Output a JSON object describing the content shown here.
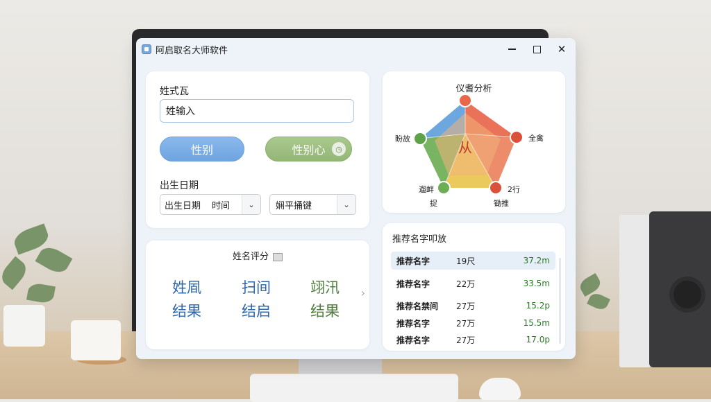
{
  "window": {
    "title": "阿启取名大师软件"
  },
  "input_panel": {
    "surname_label": "姓式瓦",
    "surname_input_value": "姓输入",
    "gender_male": "性别",
    "gender_female": "性别心",
    "birth_label": "出生日期",
    "date_select_part1": "出生日期",
    "date_select_part2": "时间",
    "hour_select_value": "娴平捅键"
  },
  "score_panel": {
    "title": "姓名评分",
    "items": [
      {
        "text": "姓凮",
        "color": "#2e67b1"
      },
      {
        "text": "扫间",
        "color": "#4f7d3f"
      },
      {
        "text": "翊汛",
        "color": "#4f7d3f"
      },
      {
        "text": "结果",
        "color": "#2e67b1"
      },
      {
        "text": "结启",
        "color": "#2e67b1"
      },
      {
        "text": "结果",
        "color": "#4f7d3f"
      }
    ]
  },
  "radar_panel": {
    "title": "仪耆分析",
    "center_char": "从",
    "labels": {
      "left": "盼故",
      "right": "全禽",
      "bottom_left_top": "遛衅",
      "bottom_left": "捉",
      "bottom_right_top": "2行",
      "bottom_right": "锄推"
    },
    "segment_colors": [
      "#e8664a",
      "#f0a35c",
      "#e9c44f",
      "#6cae55",
      "#5f9fdc"
    ]
  },
  "recommend_panel": {
    "title": "推荐名字叩放",
    "rows": [
      {
        "name": "推荐名字",
        "count": "19尺",
        "value": "37.2m",
        "selected": true
      },
      {
        "name": "推荐名字",
        "count": "22万",
        "value": "33.5m",
        "selected": false
      },
      {
        "name": "推荐名禁间",
        "count": "27万",
        "value": "15.2p",
        "selected": false
      },
      {
        "name": "推荐名字",
        "count": "27万",
        "value": "15.5m",
        "selected": false
      },
      {
        "name": "推荐名字",
        "count": "27万",
        "value": "17.0p",
        "selected": false
      }
    ]
  }
}
